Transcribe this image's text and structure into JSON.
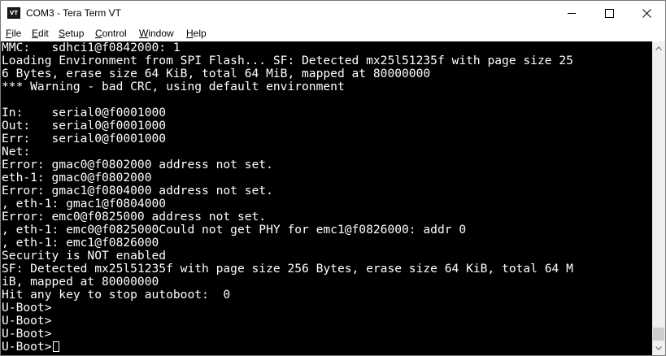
{
  "window": {
    "title": "COM3 - Tera Term VT",
    "icon_text": "VT",
    "icon": "teraterm-vt-icon"
  },
  "controls": {
    "minimize_icon": "minimize-icon",
    "maximize_icon": "maximize-icon",
    "close_icon": "close-icon"
  },
  "menu": [
    {
      "accel": "F",
      "rest": "ile"
    },
    {
      "accel": "E",
      "rest": "dit"
    },
    {
      "accel": "S",
      "rest": "etup"
    },
    {
      "accel": "C",
      "rest": "ontrol"
    },
    {
      "accel": "W",
      "rest": "indow"
    },
    {
      "accel": "H",
      "rest": "elp"
    }
  ],
  "terminal": {
    "foreground": "#ffffff",
    "background": "#000000",
    "lines": [
      "MMC:   sdhci1@f0842000: 1",
      "Loading Environment from SPI Flash... SF: Detected mx25l51235f with page size 25",
      "6 Bytes, erase size 64 KiB, total 64 MiB, mapped at 80000000",
      "*** Warning - bad CRC, using default environment",
      "",
      "In:    serial0@f0001000",
      "Out:   serial0@f0001000",
      "Err:   serial0@f0001000",
      "Net:",
      "Error: gmac0@f0802000 address not set.",
      "eth-1: gmac0@f0802000",
      "Error: gmac1@f0804000 address not set.",
      ", eth-1: gmac1@f0804000",
      "Error: emc0@f0825000 address not set.",
      ", eth-1: emc0@f0825000Could not get PHY for emc1@f0826000: addr 0",
      ", eth-1: emc1@f0826000",
      "Security is NOT enabled",
      "SF: Detected mx25l51235f with page size 256 Bytes, erase size 64 KiB, total 64 M",
      "iB, mapped at 80000000",
      "Hit any key to stop autoboot:  0",
      "U-Boot>",
      "U-Boot>",
      "U-Boot>",
      "U-Boot>"
    ]
  },
  "scrollbar": {
    "up_icon": "scroll-up-arrow-icon",
    "down_icon": "scroll-down-arrow-icon",
    "position_fraction": 1.0
  }
}
